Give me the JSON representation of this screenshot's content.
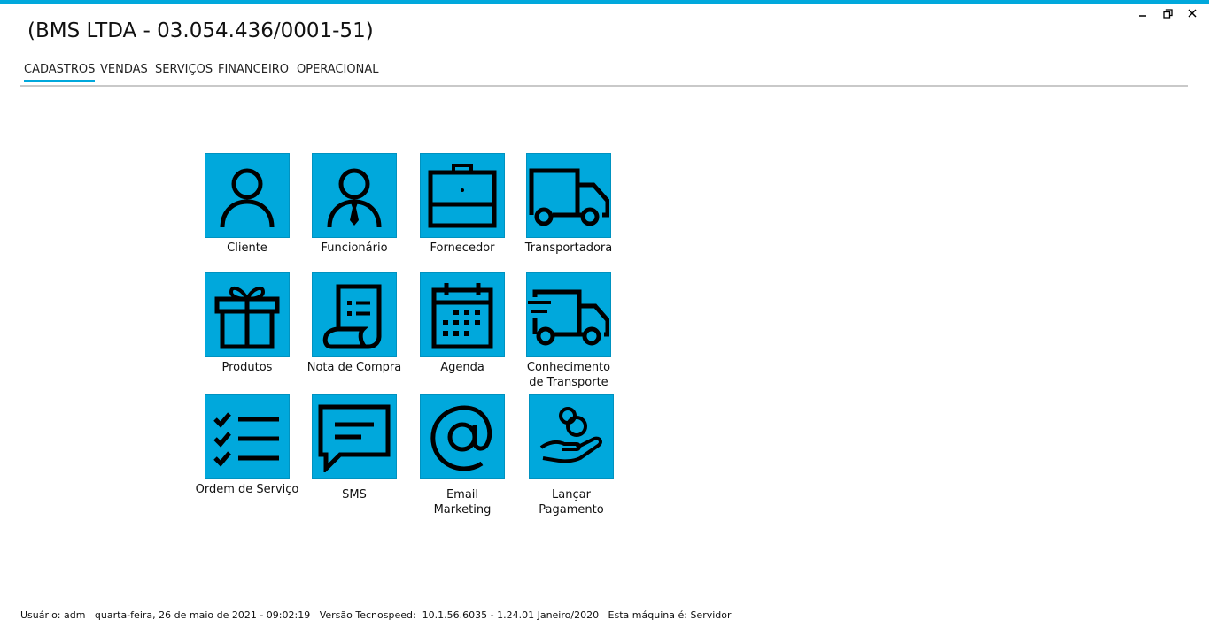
{
  "window": {
    "title": "(BMS LTDA - 03.054.436/0001-51)",
    "controls": {
      "minimize": "‒",
      "restore": "🗗",
      "close": "✕"
    }
  },
  "menu": {
    "items": [
      {
        "label": "CADASTROS",
        "active": true
      },
      {
        "label": "VENDAS"
      },
      {
        "label": "SERVIÇOS"
      },
      {
        "label": "FINANCEIRO"
      },
      {
        "label": "OPERACIONAL"
      }
    ]
  },
  "tiles": [
    {
      "label": "Cliente",
      "icon": "user-icon"
    },
    {
      "label": "Funcionário",
      "icon": "employee-icon"
    },
    {
      "label": "Fornecedor",
      "icon": "briefcase-icon"
    },
    {
      "label": "Transportadora",
      "icon": "truck-icon"
    },
    {
      "label": "Produtos",
      "icon": "gift-icon"
    },
    {
      "label": "Nota de Compra",
      "icon": "invoice-icon"
    },
    {
      "label": "Agenda",
      "icon": "calendar-icon"
    },
    {
      "label": "Conhecimento\nde Transporte",
      "icon": "fast-truck-icon"
    },
    {
      "label": "Ordem de Serviço",
      "icon": "checklist-icon"
    },
    {
      "label": "SMS",
      "icon": "chat-icon"
    },
    {
      "label": "Email\nMarketing",
      "icon": "at-icon"
    },
    {
      "label": "Lançar\nPagamento",
      "icon": "hand-coin-icon"
    }
  ],
  "status": {
    "text": "Usuário: adm   quarta-feira, 26 de maio de 2021 - 09:02:19   Versão Tecnospeed:  10.1.56.6035 - 1.24.01 Janeiro/2020   Esta máquina é: Servidor"
  },
  "colors": {
    "accent": "#00a8dc",
    "icon": "#000000"
  }
}
